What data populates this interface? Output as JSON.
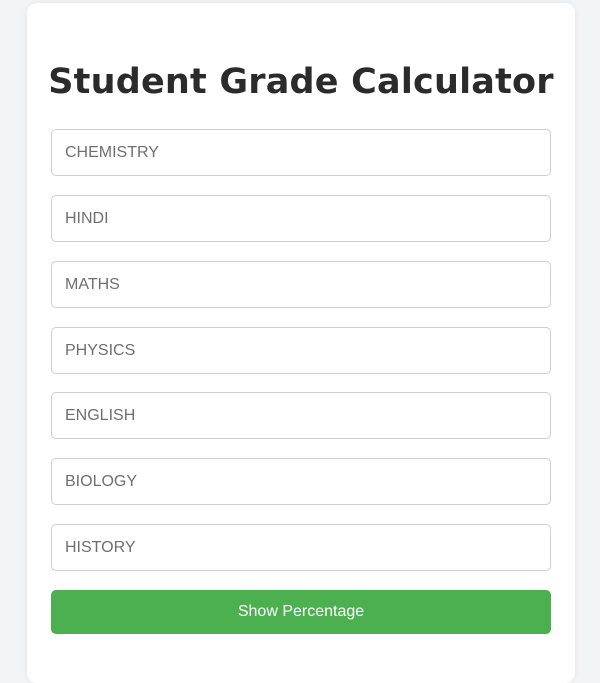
{
  "form": {
    "title": "Student Grade Calculator",
    "fields": [
      {
        "placeholder": "CHEMISTRY",
        "value": ""
      },
      {
        "placeholder": "HINDI",
        "value": ""
      },
      {
        "placeholder": "MATHS",
        "value": ""
      },
      {
        "placeholder": "PHYSICS",
        "value": ""
      },
      {
        "placeholder": "ENGLISH",
        "value": ""
      },
      {
        "placeholder": "BIOLOGY",
        "value": ""
      },
      {
        "placeholder": "HISTORY",
        "value": ""
      }
    ],
    "submit_label": "Show Percentage"
  },
  "colors": {
    "page_background": "#f3f4f6",
    "card_background": "#ffffff",
    "title_text": "#2b2b2b",
    "field_border": "#cfcfcf",
    "placeholder_text": "#6f6f6f",
    "button_background": "#4caf50",
    "button_text": "#ffffff"
  }
}
